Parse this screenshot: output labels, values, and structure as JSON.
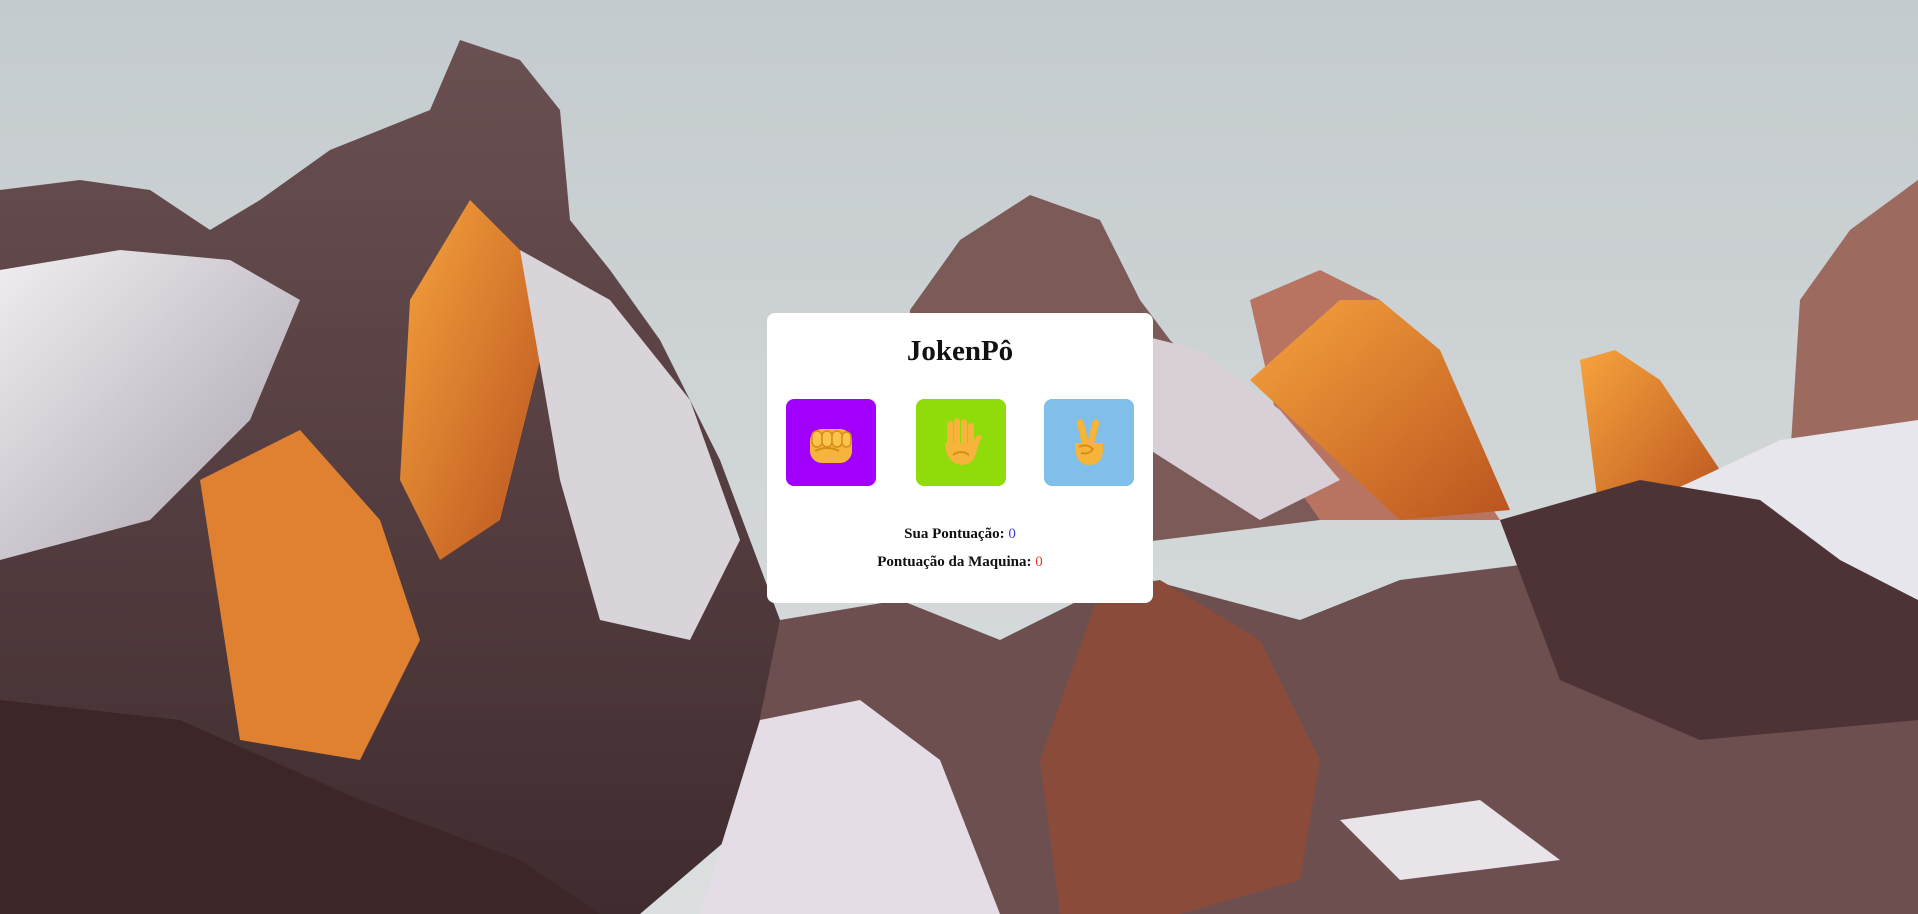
{
  "background": {
    "image": "mountain-landscape",
    "sky_color": "#cdd3d4",
    "rock_color": "#5f4748",
    "glow_color": "#f08a2c",
    "snow_color": "#e6e4ea"
  },
  "game": {
    "title": "JokenPô",
    "choices": [
      {
        "name": "rock",
        "icon": "fist-icon",
        "color": "#a100ff"
      },
      {
        "name": "paper",
        "icon": "raised-hand-icon",
        "color": "#8fdc0a"
      },
      {
        "name": "scissors",
        "icon": "victory-hand-icon",
        "color": "#7fbfea"
      }
    ],
    "score": {
      "player_label": "Sua Pontuação:",
      "player_value": "0",
      "machine_label": "Pontuação da Maquina:",
      "machine_value": "0"
    }
  }
}
